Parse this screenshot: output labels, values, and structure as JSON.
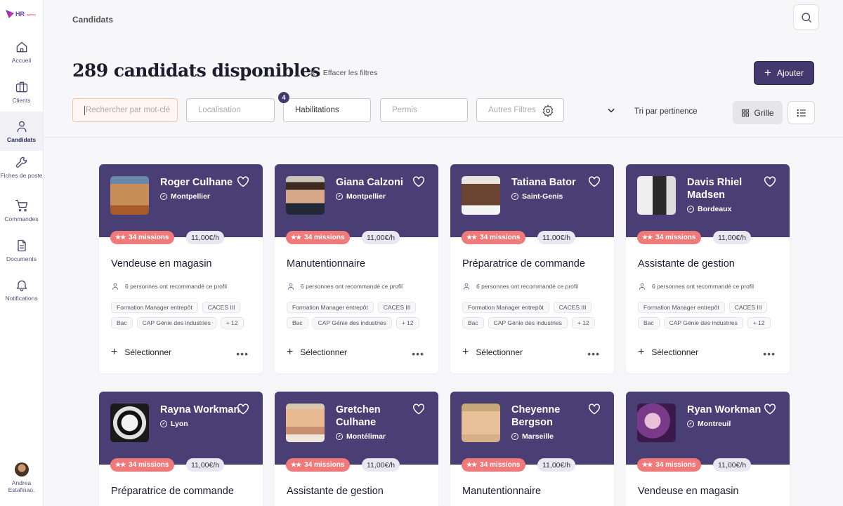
{
  "app": {
    "logo_text": "HR",
    "logo_sub": "agency"
  },
  "sidebar": {
    "items": [
      {
        "label": "Accueil",
        "icon": "home-icon"
      },
      {
        "label": "Clients",
        "icon": "briefcase-icon"
      },
      {
        "label": "Candidats",
        "icon": "user-icon",
        "active": true
      },
      {
        "label": "Fiches de poste",
        "icon": "wrench-icon"
      },
      {
        "label": "Commandes",
        "icon": "cart-icon"
      },
      {
        "label": "Documents",
        "icon": "document-icon"
      },
      {
        "label": "Notifications",
        "icon": "bell-icon"
      }
    ],
    "user_name": "Andrea Estafinao."
  },
  "header": {
    "breadcrumb": "Candidats",
    "title": "289 candidats disponibles",
    "clear_filters": "Effacer les filtres",
    "add_label": "Ajouter"
  },
  "filters": {
    "keyword_placeholder": "Rechercher par mot-clé",
    "location_placeholder": "Localisation",
    "habilitations_value": "Habilitations",
    "habilitations_count": "4",
    "permis_placeholder": "Permis",
    "other_filters": "Autres Filtres",
    "sort_label": "Tri par pertinence",
    "grid_label": "Grille"
  },
  "colors": {
    "accent": "#43396e",
    "card_header": "#4a3f74",
    "missions_badge": "#f07a7a"
  },
  "cards": [
    {
      "name": "Roger Culhane",
      "city": "Montpellier",
      "missions": "34 missions",
      "rate": "11,00€/h",
      "job": "Vendeuse en magasin",
      "reco": "6 personnes ont recommandé ce profil",
      "tags": [
        "Formation Manager entrepôt",
        "CACES III",
        "Bac",
        "CAP Génie des industries",
        "+ 12"
      ],
      "select": "Sélectionner"
    },
    {
      "name": "Giana Calzoni",
      "city": "Montpellier",
      "missions": "34 missions",
      "rate": "11,00€/h",
      "job": "Manutentionnaire",
      "reco": "6 personnes ont recommandé ce profil",
      "tags": [
        "Formation Manager entrepôt",
        "CACES III",
        "Bac",
        "CAP Génie des industries",
        "+ 12"
      ],
      "select": "Sélectionner"
    },
    {
      "name": "Tatiana Bator",
      "city": "Saint-Genis",
      "missions": "34 missions",
      "rate": "11,00€/h",
      "job": "Préparatrice de commande",
      "reco": "6 personnes ont recommandé ce profil",
      "tags": [
        "Formation Manager entrepôt",
        "CACES III",
        "Bac",
        "CAP Génie des industries",
        "+ 12"
      ],
      "select": "Sélectionner"
    },
    {
      "name": "Davis Rhiel Madsen",
      "city": "Bordeaux",
      "missions": "34 missions",
      "rate": "11,00€/h",
      "job": "Assistante de gestion",
      "reco": "6 personnes ont recommandé ce profil",
      "tags": [
        "Formation Manager entrepôt",
        "CACES III",
        "Bac",
        "CAP Génie des industries",
        "+ 12"
      ],
      "select": "Sélectionner"
    },
    {
      "name": "Rayna Workman",
      "city": "Lyon",
      "missions": "34 missions",
      "rate": "11,00€/h",
      "job": "Préparatrice de commande"
    },
    {
      "name": "Gretchen Culhane",
      "city": "Montélimar",
      "missions": "34 missions",
      "rate": "11,00€/h",
      "job": "Assistante de gestion"
    },
    {
      "name": "Cheyenne Bergson",
      "city": "Marseille",
      "missions": "34 missions",
      "rate": "11,00€/h",
      "job": "Manutentionnaire"
    },
    {
      "name": "Ryan Workman",
      "city": "Montreuil",
      "missions": "34 missions",
      "rate": "11,00€/h",
      "job": "Vendeuse en magasin"
    }
  ]
}
